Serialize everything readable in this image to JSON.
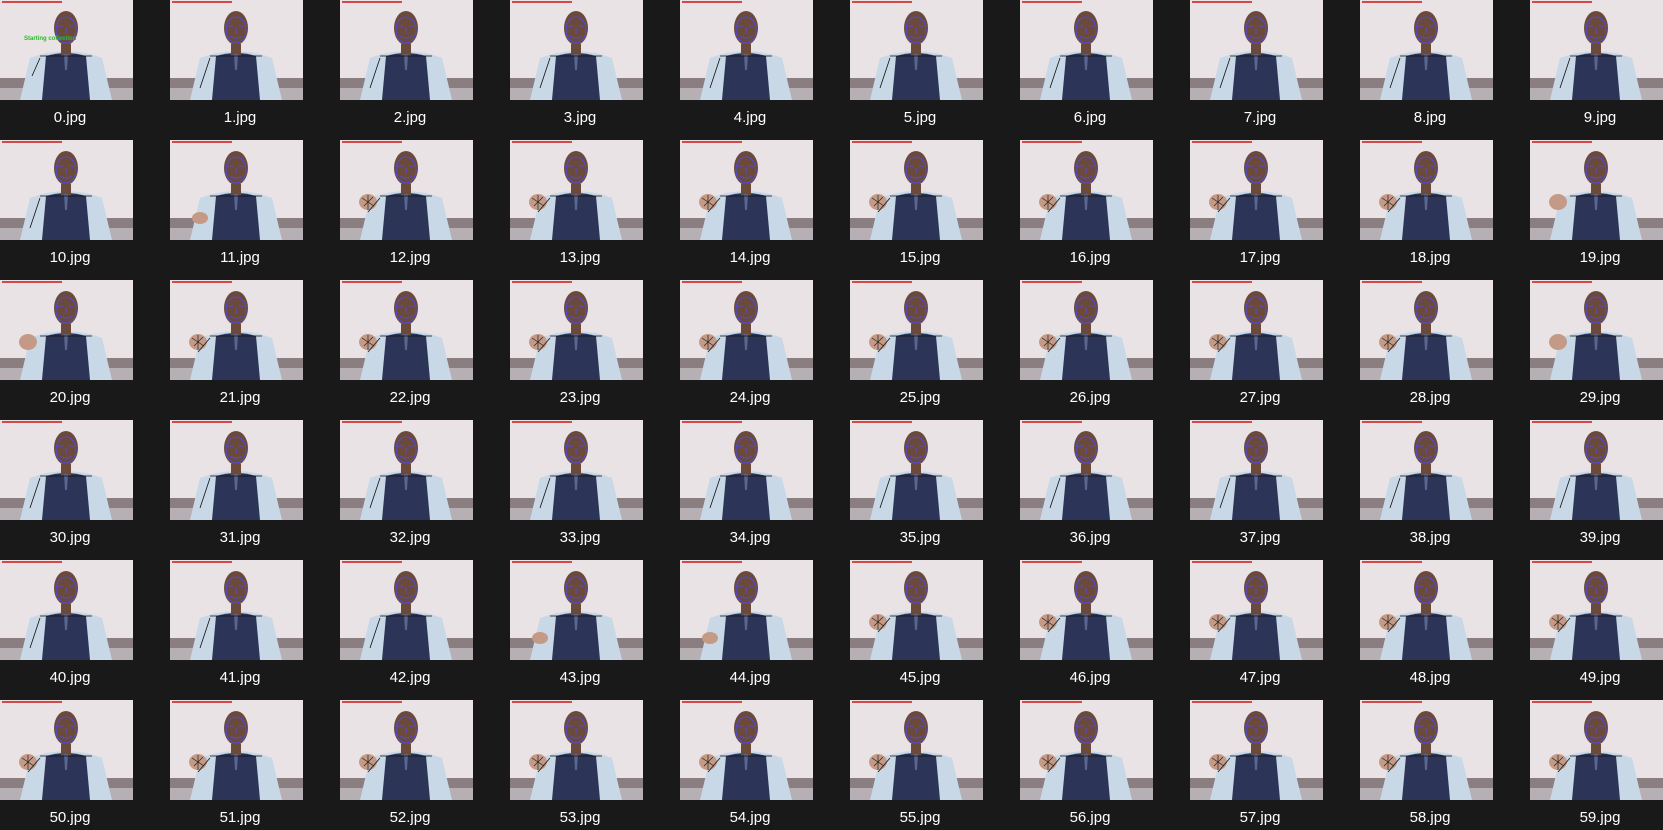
{
  "folder": {
    "view": "large-icons",
    "items": [
      {
        "name": "0.jpg",
        "banner": "Starting collection",
        "hand": "raised-left"
      },
      {
        "name": "1.jpg",
        "hand": "lowered"
      },
      {
        "name": "2.jpg",
        "hand": "lowered"
      },
      {
        "name": "3.jpg",
        "hand": "lowered"
      },
      {
        "name": "4.jpg",
        "hand": "lowered"
      },
      {
        "name": "5.jpg",
        "hand": "lowered"
      },
      {
        "name": "6.jpg",
        "hand": "lowered"
      },
      {
        "name": "7.jpg",
        "hand": "lowered"
      },
      {
        "name": "8.jpg",
        "hand": "lowered"
      },
      {
        "name": "9.jpg",
        "hand": "lowered"
      },
      {
        "name": "10.jpg",
        "hand": "lowered"
      },
      {
        "name": "11.jpg",
        "hand": "rising"
      },
      {
        "name": "12.jpg",
        "hand": "fist-tracked"
      },
      {
        "name": "13.jpg",
        "hand": "fist-tracked"
      },
      {
        "name": "14.jpg",
        "hand": "fist-tracked"
      },
      {
        "name": "15.jpg",
        "hand": "fist-tracked"
      },
      {
        "name": "16.jpg",
        "hand": "fist-tracked"
      },
      {
        "name": "17.jpg",
        "hand": "fist-tracked"
      },
      {
        "name": "18.jpg",
        "hand": "fist-tracked"
      },
      {
        "name": "19.jpg",
        "hand": "fist"
      },
      {
        "name": "20.jpg",
        "hand": "fist"
      },
      {
        "name": "21.jpg",
        "hand": "fist-tracked"
      },
      {
        "name": "22.jpg",
        "hand": "fist-tracked"
      },
      {
        "name": "23.jpg",
        "hand": "fist-tracked"
      },
      {
        "name": "24.jpg",
        "hand": "fist-tracked"
      },
      {
        "name": "25.jpg",
        "hand": "fist-tracked"
      },
      {
        "name": "26.jpg",
        "hand": "fist-tracked"
      },
      {
        "name": "27.jpg",
        "hand": "fist-tracked"
      },
      {
        "name": "28.jpg",
        "hand": "fist-tracked"
      },
      {
        "name": "29.jpg",
        "hand": "fist"
      },
      {
        "name": "30.jpg",
        "hand": "lowered"
      },
      {
        "name": "31.jpg",
        "hand": "lowered"
      },
      {
        "name": "32.jpg",
        "hand": "lowered"
      },
      {
        "name": "33.jpg",
        "hand": "lowered"
      },
      {
        "name": "34.jpg",
        "hand": "lowered"
      },
      {
        "name": "35.jpg",
        "hand": "lowered"
      },
      {
        "name": "36.jpg",
        "hand": "lowered"
      },
      {
        "name": "37.jpg",
        "hand": "lowered"
      },
      {
        "name": "38.jpg",
        "hand": "lowered"
      },
      {
        "name": "39.jpg",
        "hand": "lowered"
      },
      {
        "name": "40.jpg",
        "hand": "lowered"
      },
      {
        "name": "41.jpg",
        "hand": "lowered"
      },
      {
        "name": "42.jpg",
        "hand": "lowered"
      },
      {
        "name": "43.jpg",
        "hand": "rising"
      },
      {
        "name": "44.jpg",
        "hand": "rising"
      },
      {
        "name": "45.jpg",
        "hand": "fist-tracked"
      },
      {
        "name": "46.jpg",
        "hand": "fist-tracked"
      },
      {
        "name": "47.jpg",
        "hand": "fist-tracked"
      },
      {
        "name": "48.jpg",
        "hand": "fist-tracked"
      },
      {
        "name": "49.jpg",
        "hand": "fist-tracked"
      },
      {
        "name": "50.jpg",
        "hand": "fist-tracked"
      },
      {
        "name": "51.jpg",
        "hand": "fist-tracked"
      },
      {
        "name": "52.jpg",
        "hand": "fist-tracked"
      },
      {
        "name": "53.jpg",
        "hand": "fist-tracked"
      },
      {
        "name": "54.jpg",
        "hand": "fist-tracked"
      },
      {
        "name": "55.jpg",
        "hand": "fist-tracked"
      },
      {
        "name": "56.jpg",
        "hand": "fist-tracked"
      },
      {
        "name": "57.jpg",
        "hand": "fist-tracked"
      },
      {
        "name": "58.jpg",
        "hand": "fist-tracked"
      },
      {
        "name": "59.jpg",
        "hand": "fist-tracked"
      }
    ]
  },
  "colors": {
    "background": "#191919",
    "caption": "#ffffff",
    "wall": "#e9e3e6",
    "vest": "#2c3458",
    "shirt": "#c9d8e6",
    "skin": "#6b4a3c",
    "landmarks": "#4a4cf0",
    "overlay_text": "#d02020",
    "banner_text": "#22c022"
  }
}
